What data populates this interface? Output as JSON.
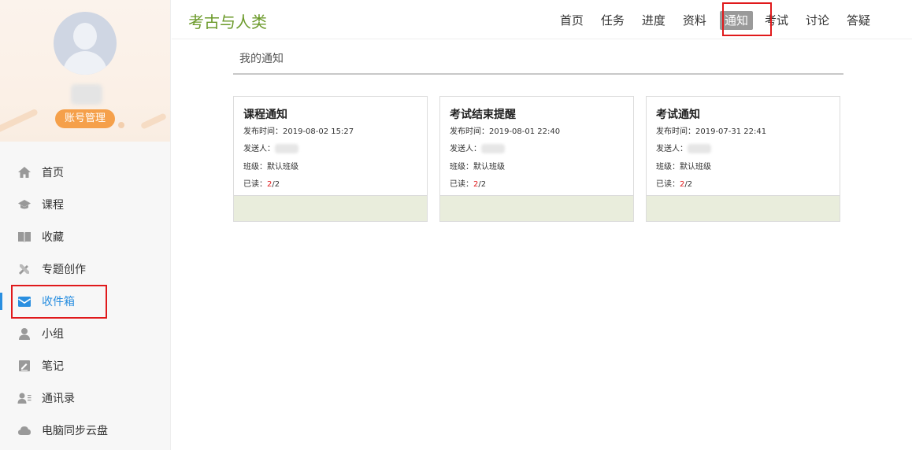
{
  "sidebar": {
    "account_button": "账号管理",
    "items": [
      {
        "label": "首页",
        "icon": "home-icon"
      },
      {
        "label": "课程",
        "icon": "graduation-cap-icon"
      },
      {
        "label": "收藏",
        "icon": "book-icon"
      },
      {
        "label": "专题创作",
        "icon": "tools-icon"
      },
      {
        "label": "收件箱",
        "icon": "inbox-icon",
        "active": true
      },
      {
        "label": "小组",
        "icon": "person-icon"
      },
      {
        "label": "笔记",
        "icon": "note-icon"
      },
      {
        "label": "通讯录",
        "icon": "contacts-icon"
      },
      {
        "label": "电脑同步云盘",
        "icon": "cloud-icon"
      }
    ]
  },
  "header": {
    "course_title": "考古与人类",
    "nav": [
      "首页",
      "任务",
      "进度",
      "资料",
      "通知",
      "考试",
      "讨论",
      "答疑"
    ],
    "active_nav": "通知"
  },
  "main": {
    "section_title": "我的通知",
    "cards": [
      {
        "title": "课程通知",
        "publish_label": "发布时间：",
        "publish_time": "2019-08-02 15:27",
        "sender_label": "发送人：",
        "class_label": "班级：",
        "class_name": "默认班级",
        "read_label": "已读：",
        "read_count": "2",
        "read_total": "/2"
      },
      {
        "title": "考试结束提醒",
        "publish_label": "发布时间：",
        "publish_time": "2019-08-01 22:40",
        "sender_label": "发送人：",
        "class_label": "班级：",
        "class_name": "默认班级",
        "read_label": "已读：",
        "read_count": "2",
        "read_total": "/2"
      },
      {
        "title": "考试通知",
        "publish_label": "发布时间：",
        "publish_time": "2019-07-31 22:41",
        "sender_label": "发送人：",
        "class_label": "班级：",
        "class_name": "默认班级",
        "read_label": "已读：",
        "read_count": "2",
        "read_total": "/2"
      }
    ]
  },
  "colors": {
    "accent_blue": "#2a8fe0",
    "title_green": "#6b9a2a",
    "account_orange": "#f5a04a",
    "highlight_red": "#e0191b",
    "card_footer": "#e9eddc"
  }
}
